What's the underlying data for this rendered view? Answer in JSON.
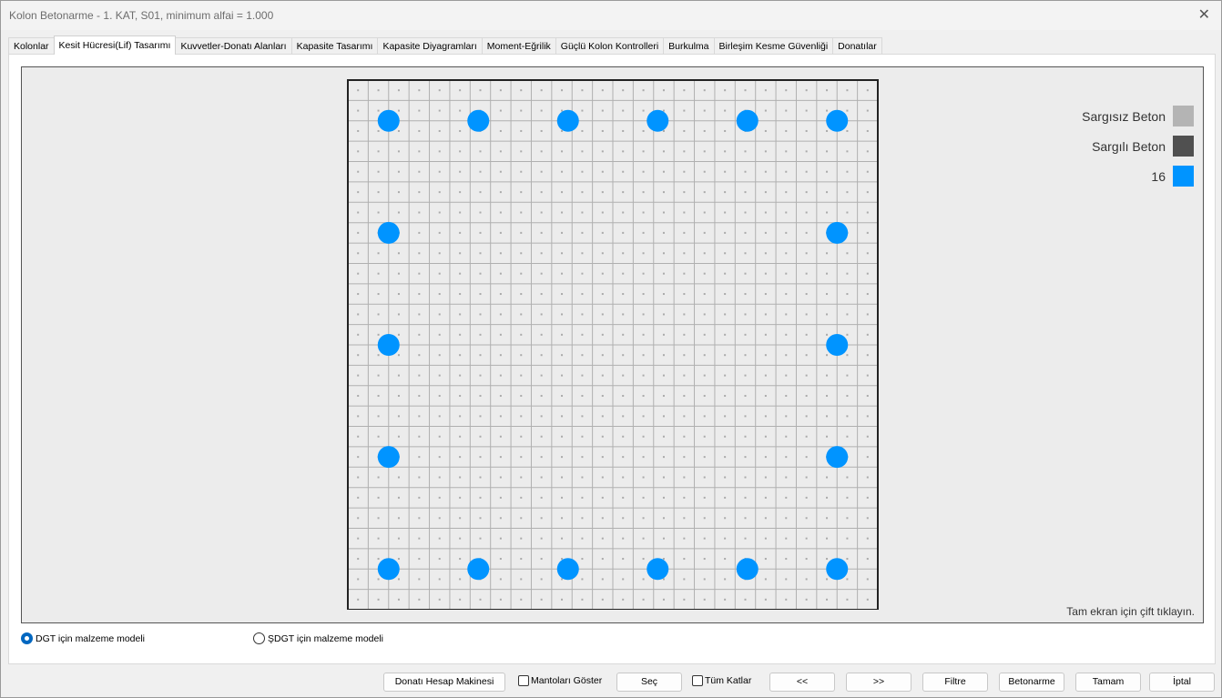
{
  "window": {
    "title": "Kolon Betonarme - 1. KAT, S01, minimum alfai = 1.000",
    "close": "✕"
  },
  "tabs": [
    "Kolonlar",
    "Kesit Hücresi(Lif) Tasarımı",
    "Kuvvetler-Donatı Alanları",
    "Kapasite Tasarımı",
    "Kapasite Diyagramları",
    "Moment-Eğrilik",
    "Güçlü Kolon Kontrolleri",
    "Burkulma",
    "Birleşim Kesme Güvenliği",
    "Donatılar"
  ],
  "active_tab": 1,
  "legend": [
    {
      "label": "Sargısız Beton",
      "color": "#b4b4b4"
    },
    {
      "label": "Sargılı Beton",
      "color": "#505050"
    },
    {
      "label": "16",
      "color": "#0094ff"
    }
  ],
  "hint": "Tam ekran için çift tıklayın.",
  "radios": {
    "dgt": "DGT için malzeme modeli",
    "sdgt": "ŞDGT için malzeme modeli",
    "selected": "dgt"
  },
  "buttons": {
    "calc": "Donatı Hesap Makinesi",
    "show_jackets": "Mantoları Göster",
    "select": "Seç",
    "all_floors": "Tüm Katlar",
    "prev": "<<",
    "next": ">>",
    "filter": "Filtre",
    "concrete": "Betonarme",
    "ok": "Tamam",
    "cancel": "İptal"
  },
  "colors": {
    "bar": "#0094ff",
    "grid": "#b0b0b0",
    "fill": "#ececec"
  }
}
